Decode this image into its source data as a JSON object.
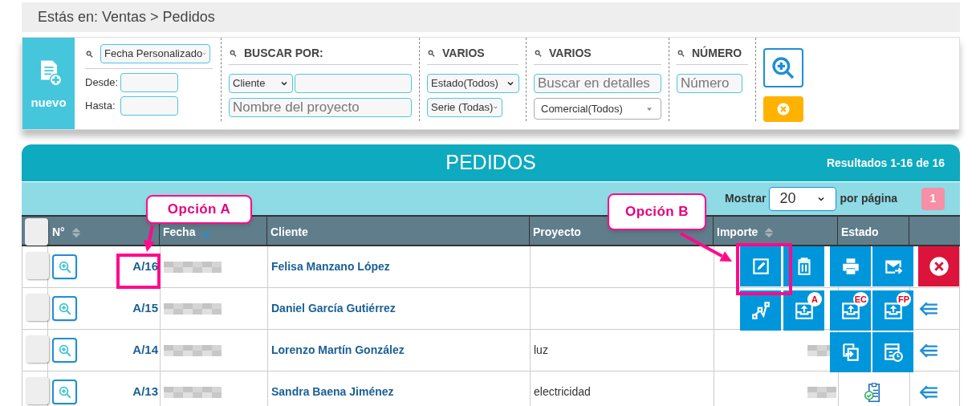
{
  "breadcrumb": "Estás en: Ventas > Pedidos",
  "filters": {
    "new_button": "nuevo",
    "date": {
      "select": "Fecha Personalizado",
      "from_label": "Desde:",
      "to_label": "Hasta:"
    },
    "search_by": {
      "title": "BUSCAR POR:",
      "field_select": "Cliente",
      "project_placeholder": "Nombre del proyecto"
    },
    "various_1": {
      "title": "VARIOS",
      "status_select": "Estado(Todos)",
      "series_select": "Serie (Todas)"
    },
    "various_2": {
      "title": "VARIOS",
      "details_placeholder": "Buscar en detalles",
      "sales_select": "Comercial(Todos)"
    },
    "number": {
      "title": "NÚMERO",
      "placeholder": "Número"
    }
  },
  "table": {
    "title": "PEDIDOS",
    "results": "Resultados 1-16 de 16",
    "show_label": "Mostrar",
    "page_size": "20",
    "per_page_label": "por página",
    "pages": [
      {
        "label": "1",
        "selected": true
      }
    ],
    "header_checked": false,
    "columns": [
      {
        "label": "N°",
        "sorted": false
      },
      {
        "label": "Fecha",
        "sorted": true
      },
      {
        "label": "Cliente"
      },
      {
        "label": "Proyecto"
      },
      {
        "label": "Importe",
        "sorted": false
      },
      {
        "label": "Estado"
      }
    ],
    "rows": [
      {
        "checked": false,
        "number": "A/16",
        "client": "Felisa Manzano López",
        "project": null,
        "importe_blurred": false
      },
      {
        "checked": false,
        "number": "A/15",
        "client": "Daniel García Gutiérrez",
        "project": null,
        "importe_blurred": false
      },
      {
        "checked": false,
        "number": "A/14",
        "client": "Lorenzo Martín González",
        "project": "luz",
        "importe_blurred": true
      },
      {
        "checked": false,
        "number": "A/13",
        "client": "Sandra Baena Jiménez",
        "project": "electricidad",
        "importe_blurred": true,
        "status_check": true
      }
    ]
  },
  "action_menu": [
    {
      "kind": "edit"
    },
    {
      "kind": "delete"
    },
    {
      "kind": "print"
    },
    {
      "kind": "email"
    },
    {
      "kind": "workflow"
    },
    {
      "kind": "upload",
      "badge": "A"
    },
    {
      "kind": "upload",
      "badge": "EC"
    },
    {
      "kind": "upload",
      "badge": "FP"
    },
    {
      "kind": "copy"
    },
    {
      "kind": "schedule"
    },
    {
      "kind": "close"
    }
  ],
  "annotations": [
    {
      "label": "Opción A"
    },
    {
      "label": "Opción B"
    }
  ]
}
